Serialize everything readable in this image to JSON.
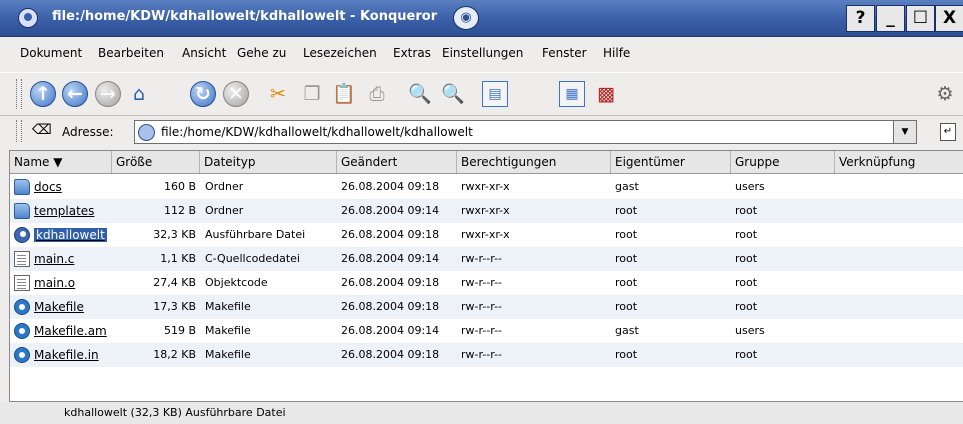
{
  "window": {
    "title": "file:/home/KDW/kdhallowelt/kdhallowelt - Konqueror",
    "buttons": {
      "help": "?",
      "minimize": "_",
      "maximize": "☐",
      "close": "X"
    }
  },
  "menubar": [
    "Dokument",
    "Bearbeiten",
    "Ansicht",
    "Gehe zu",
    "Lesezeichen",
    "Extras",
    "Einstellungen",
    "Fenster",
    "Hilfe"
  ],
  "toolbar": [
    "up-icon",
    "back-icon",
    "forward-icon",
    "home-icon",
    "reload-icon",
    "stop-icon",
    "cut-icon",
    "copy-icon",
    "paste-icon",
    "print-icon",
    "zoom-in-icon",
    "zoom-out-icon",
    "icon-view-icon",
    "detail-view-icon",
    "firewall-icon",
    "konqueror-logo-icon"
  ],
  "address": {
    "label": "Adresse:",
    "value": "file:/home/KDW/kdhallowelt/kdhallowelt/kdhallowelt"
  },
  "columns": [
    "Name",
    "Größe",
    "Dateityp",
    "Geändert",
    "Berechtigungen",
    "Eigentümer",
    "Gruppe",
    "Verknüpfung"
  ],
  "files": [
    {
      "name": "docs",
      "size": "160 B",
      "type": "Ordner",
      "modified": "26.08.2004 09:18",
      "perms": "rwxr-xr-x",
      "owner": "gast",
      "group": "users",
      "link": "",
      "icon": "folder"
    },
    {
      "name": "templates",
      "size": "112 B",
      "type": "Ordner",
      "modified": "26.08.2004 09:14",
      "perms": "rwxr-xr-x",
      "owner": "root",
      "group": "root",
      "link": "",
      "icon": "folder"
    },
    {
      "name": "kdhallowelt",
      "size": "32,3 KB",
      "type": "Ausführbare Datei",
      "modified": "26.08.2004 09:18",
      "perms": "rwxr-xr-x",
      "owner": "root",
      "group": "root",
      "link": "",
      "icon": "exec"
    },
    {
      "name": "main.c",
      "size": "1,1 KB",
      "type": "C-Quellcodedatei",
      "modified": "26.08.2004 09:14",
      "perms": "rw-r--r--",
      "owner": "root",
      "group": "root",
      "link": "",
      "icon": "doc"
    },
    {
      "name": "main.o",
      "size": "27,4 KB",
      "type": "Objektcode",
      "modified": "26.08.2004 09:18",
      "perms": "rw-r--r--",
      "owner": "root",
      "group": "root",
      "link": "",
      "icon": "doc"
    },
    {
      "name": "Makefile",
      "size": "17,3 KB",
      "type": "Makefile",
      "modified": "26.08.2004 09:18",
      "perms": "rw-r--r--",
      "owner": "root",
      "group": "root",
      "link": "",
      "icon": "make"
    },
    {
      "name": "Makefile.am",
      "size": "519 B",
      "type": "Makefile",
      "modified": "26.08.2004 09:14",
      "perms": "rw-r--r--",
      "owner": "gast",
      "group": "users",
      "link": "",
      "icon": "make"
    },
    {
      "name": "Makefile.in",
      "size": "18,2 KB",
      "type": "Makefile",
      "modified": "26.08.2004 09:18",
      "perms": "rw-r--r--",
      "owner": "root",
      "group": "root",
      "link": "",
      "icon": "make"
    }
  ],
  "selected_file": "kdhallowelt",
  "status": "kdhallowelt (32,3 KB)  Ausführbare Datei"
}
